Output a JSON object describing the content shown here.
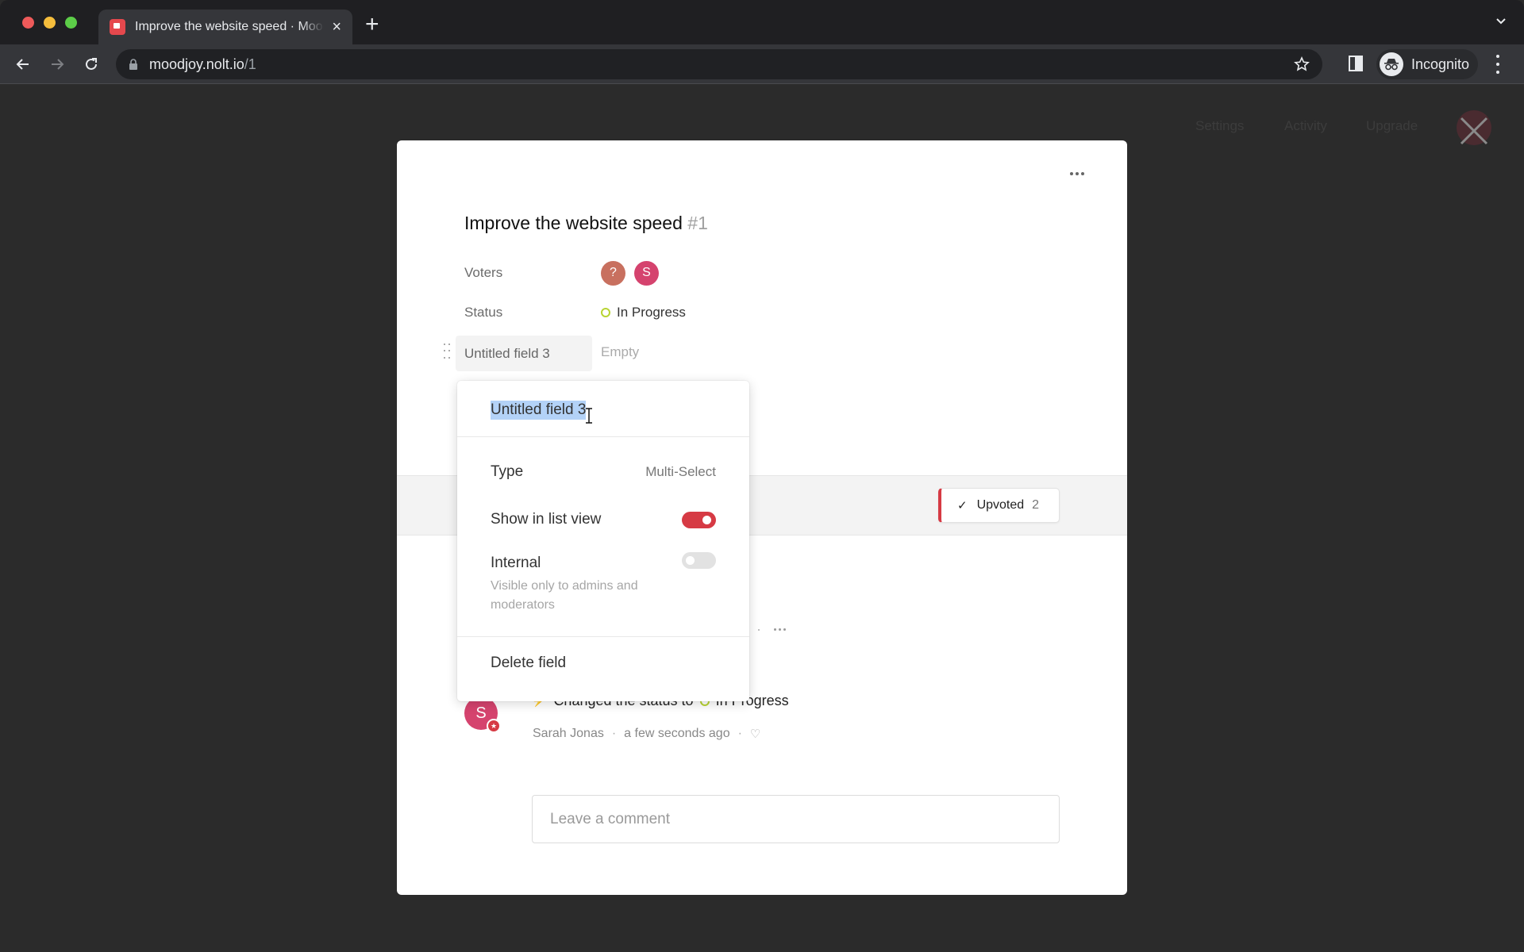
{
  "browser": {
    "tab_title": "Improve the website speed · Moodjoy",
    "url_host": "moodjoy.nolt.io",
    "url_path": "/1",
    "profile_label": "Incognito"
  },
  "background_nav": {
    "items": [
      "Settings",
      "Activity",
      "Upgrade"
    ]
  },
  "post": {
    "title": "Improve the website speed",
    "number": "#1",
    "fields": {
      "voters_label": "Voters",
      "voters": [
        {
          "initial": "?",
          "color": "#c8705f"
        },
        {
          "initial": "S",
          "color": "#d5436e"
        }
      ],
      "status_label": "Status",
      "status_value": "In Progress",
      "status_color": "#b8d432",
      "custom_field_label": "Untitled field 3",
      "custom_field_value": "Empty"
    },
    "upvote": {
      "check": "✓",
      "label": "Upvoted",
      "count": "2"
    }
  },
  "field_popover": {
    "name_value": "Untitled field 3",
    "type_label": "Type",
    "type_value": "Multi-Select",
    "show_in_list_label": "Show in list view",
    "show_in_list_on": true,
    "internal_label": "Internal",
    "internal_on": false,
    "internal_help": "Visible only to admins and moderators",
    "delete_label": "Delete field"
  },
  "activity": {
    "avatar_initial": "S",
    "action_text": "Changed the status to",
    "status_value": "In Progress",
    "author": "Sarah Jonas",
    "time": "a few seconds ago"
  },
  "comment": {
    "placeholder": "Leave a comment"
  },
  "colors": {
    "accent": "#d63a44",
    "status_in_progress": "#b8d432"
  }
}
